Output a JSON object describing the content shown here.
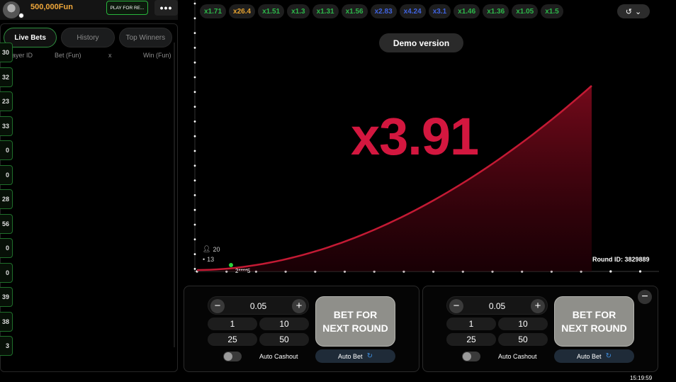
{
  "user": {
    "balance": "500,000Fun",
    "play_real_label": "PLAY FOR RE...",
    "menu_label": "•••"
  },
  "bets_panel": {
    "tabs": [
      {
        "label": "Live Bets",
        "active": true
      },
      {
        "label": "History",
        "active": false
      },
      {
        "label": "Top Winners",
        "active": false
      }
    ],
    "columns": [
      "Player ID",
      "Bet (Fun)",
      "x",
      "Win (Fun)"
    ],
    "row_fragments": [
      "30",
      "32",
      "23",
      "33",
      "0",
      "0",
      "28",
      "56",
      "0",
      "0",
      "39",
      "38",
      "3"
    ]
  },
  "history": {
    "items": [
      {
        "value": "x1.71",
        "color": "#2db84a"
      },
      {
        "value": "x26.4",
        "color": "#e5a22f"
      },
      {
        "value": "x1.51",
        "color": "#2db84a"
      },
      {
        "value": "x1.3",
        "color": "#2db84a"
      },
      {
        "value": "x1.31",
        "color": "#2db84a"
      },
      {
        "value": "x1.56",
        "color": "#2db84a"
      },
      {
        "value": "x2.83",
        "color": "#3f63e0"
      },
      {
        "value": "x4.24",
        "color": "#3f63e0"
      },
      {
        "value": "x3.1",
        "color": "#3f63e0"
      },
      {
        "value": "x1.46",
        "color": "#2db84a"
      },
      {
        "value": "x1.36",
        "color": "#2db84a"
      },
      {
        "value": "x1.05",
        "color": "#2db84a"
      },
      {
        "value": "x1.5",
        "color": "#2db84a"
      }
    ],
    "toggle_icon": "history-icon"
  },
  "game": {
    "demo_label": "Demo version",
    "multiplier": "x3.91",
    "multiplier_color": "#d3173f",
    "round_id_label": "Round ID:",
    "round_id": "3829889",
    "players_count": "20",
    "bets_count": "13",
    "cashout_player": "2****5"
  },
  "bet_panels": [
    {
      "amount": "0.05",
      "quick_amounts": [
        "1",
        "10",
        "25",
        "50"
      ],
      "bet_label": "BET FOR NEXT ROUND",
      "auto_cashout_label": "Auto Cashout",
      "auto_bet_label": "Auto Bet"
    },
    {
      "amount": "0.05",
      "quick_amounts": [
        "1",
        "10",
        "25",
        "50"
      ],
      "bet_label": "BET FOR NEXT ROUND",
      "auto_cashout_label": "Auto Cashout",
      "auto_bet_label": "Auto Bet"
    }
  ],
  "clock": "15:19:59"
}
